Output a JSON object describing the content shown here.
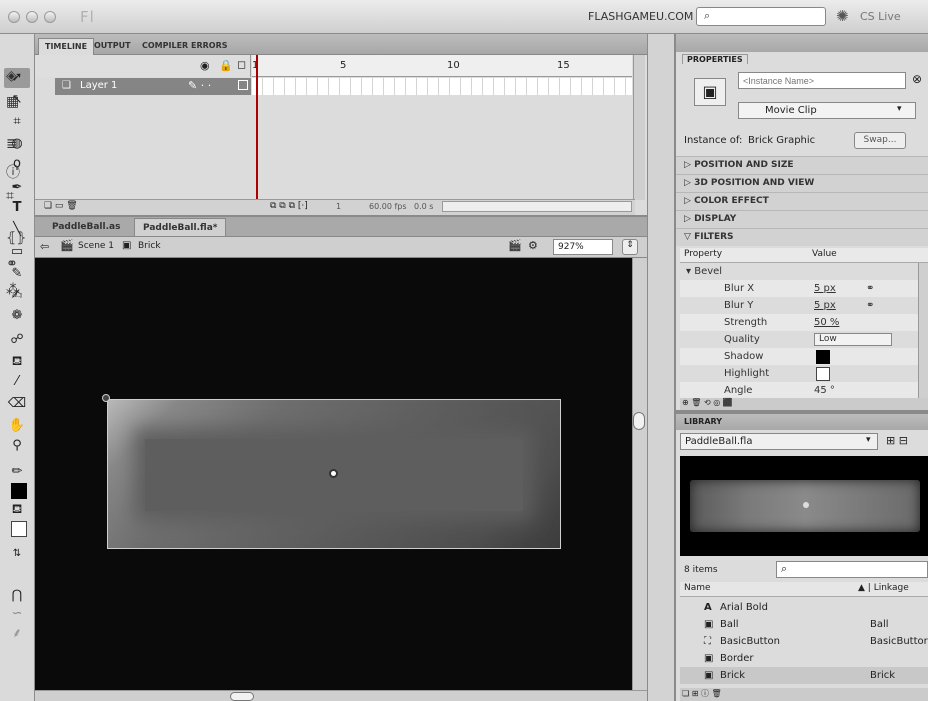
{
  "window": {
    "app_logo": "Fl",
    "workspace": "FLASHGAMEU.COM ▾",
    "cs_live": "CS Live"
  },
  "timeline": {
    "tabs": [
      "TIMELINE",
      "OUTPUT",
      "COMPILER ERRORS"
    ],
    "frame_numbers": [
      "1",
      "5",
      "10",
      "15"
    ],
    "layer_name": "Layer 1",
    "fps": "60.00 fps",
    "time": "0.0 s",
    "current_frame": "1"
  },
  "documents": {
    "tabs": [
      "PaddleBall.as",
      "PaddleBall.fla*"
    ]
  },
  "editbar": {
    "scene": "Scene 1",
    "symbol": "Brick",
    "zoom": "927%"
  },
  "properties": {
    "title": "PROPERTIES",
    "instance_placeholder": "<Instance Name>",
    "symbol_type": "Movie Clip",
    "instance_of_label": "Instance of:",
    "instance_of": "Brick Graphic",
    "swap_label": "Swap...",
    "sections": [
      "POSITION AND SIZE",
      "3D POSITION AND VIEW",
      "COLOR EFFECT",
      "DISPLAY",
      "FILTERS"
    ],
    "filter_cols": [
      "Property",
      "Value"
    ],
    "filter_name": "Bevel",
    "filter_rows": [
      {
        "prop": "Blur X",
        "value": "5 px"
      },
      {
        "prop": "Blur Y",
        "value": "5 px"
      },
      {
        "prop": "Strength",
        "value": "50 %"
      },
      {
        "prop": "Quality",
        "value": "Low"
      },
      {
        "prop": "Shadow",
        "value": ""
      },
      {
        "prop": "Highlight",
        "value": ""
      },
      {
        "prop": "Angle",
        "value": "45 °"
      }
    ],
    "colors": {
      "shadow": "#000000",
      "highlight": "#ffffff"
    }
  },
  "library": {
    "title": "LIBRARY",
    "file": "PaddleBall.fla",
    "count": "8 items",
    "col_name": "Name",
    "col_linkage": "Linkage",
    "items": [
      {
        "name": "Arial Bold",
        "linkage": "",
        "icon": "font-icon"
      },
      {
        "name": "Ball",
        "linkage": "Ball",
        "icon": "movieclip-icon"
      },
      {
        "name": "BasicButton",
        "linkage": "BasicButtor",
        "icon": "button-icon"
      },
      {
        "name": "Border",
        "linkage": "",
        "icon": "movieclip-icon"
      },
      {
        "name": "Brick",
        "linkage": "Brick",
        "icon": "movieclip-icon"
      }
    ]
  },
  "icons": [
    "selection-tool-icon",
    "subselection-tool-icon",
    "free-transform-icon",
    "3d-rotation-icon",
    "lasso-icon",
    "pen-icon",
    "text-tool-icon",
    "line-tool-icon",
    "rectangle-tool-icon",
    "pencil-icon",
    "brush-icon",
    "deco-icon",
    "bone-icon",
    "paint-bucket-icon",
    "eyedropper-icon",
    "eraser-icon",
    "hand-icon",
    "zoom-icon"
  ]
}
